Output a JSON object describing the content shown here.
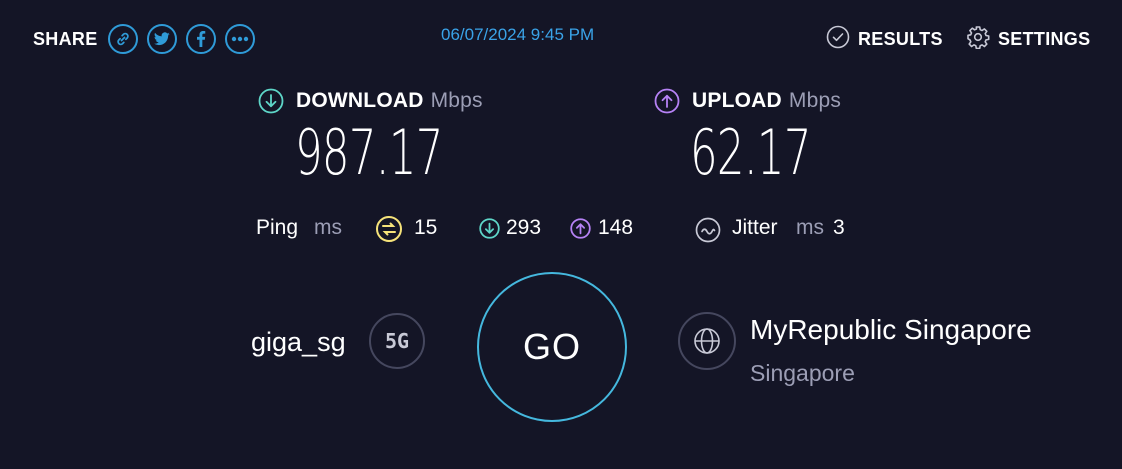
{
  "header": {
    "share_label": "SHARE",
    "share_icons": [
      "link-icon",
      "twitter-icon",
      "facebook-icon",
      "more-icon"
    ],
    "datetime": "06/07/2024 9:45 PM",
    "results_label": "RESULTS",
    "settings_label": "SETTINGS"
  },
  "download": {
    "label": "DOWNLOAD",
    "unit": "Mbps",
    "value": "987.17",
    "color": "#5ed6c8"
  },
  "upload": {
    "label": "UPLOAD",
    "unit": "Mbps",
    "value": "62.17",
    "color": "#b682f5"
  },
  "ping": {
    "label": "Ping",
    "unit": "ms",
    "idle": "15",
    "download": "293",
    "upload": "148",
    "idle_color": "#f6e37a"
  },
  "jitter": {
    "label": "Jitter",
    "unit": "ms",
    "value": "3"
  },
  "connection": {
    "network_name": "giga_sg",
    "badge": "5G"
  },
  "go_label": "GO",
  "server": {
    "provider": "MyRepublic Singapore",
    "location": "Singapore"
  },
  "colors": {
    "background": "#141526",
    "accent": "#2f9bd8",
    "go_ring": "#45b8de",
    "muted": "#9c9eb5"
  }
}
